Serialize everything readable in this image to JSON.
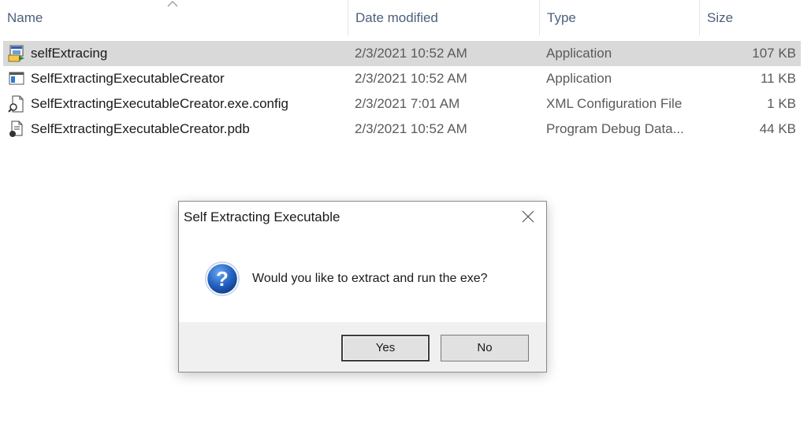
{
  "columns": {
    "name": "Name",
    "date": "Date modified",
    "type": "Type",
    "size": "Size"
  },
  "sort_indicator": "chevron-up-icon",
  "files": [
    {
      "name": "selfExtracing",
      "date": "2/3/2021 10:52 AM",
      "type": "Application",
      "size": "107 KB",
      "icon": "app-icon",
      "selected": true
    },
    {
      "name": "SelfExtractingExecutableCreator",
      "date": "2/3/2021 10:52 AM",
      "type": "Application",
      "size": "11 KB",
      "icon": "window-app-icon",
      "selected": false
    },
    {
      "name": "SelfExtractingExecutableCreator.exe.config",
      "date": "2/3/2021 7:01 AM",
      "type": "XML Configuration File",
      "size": "1 KB",
      "icon": "config-file-icon",
      "selected": false
    },
    {
      "name": "SelfExtractingExecutableCreator.pdb",
      "date": "2/3/2021 10:52 AM",
      "type": "Program Debug Data...",
      "size": "44 KB",
      "icon": "pdb-file-icon",
      "selected": false
    }
  ],
  "dialog": {
    "title": "Self Extracting Executable",
    "message": "Would you like to extract and run the exe?",
    "icon": "question-icon",
    "yes_label": "Yes",
    "no_label": "No"
  },
  "colors": {
    "selection": "#d9d9d9",
    "header_text": "#4c607a",
    "question_blue": "#1f5fb8"
  }
}
